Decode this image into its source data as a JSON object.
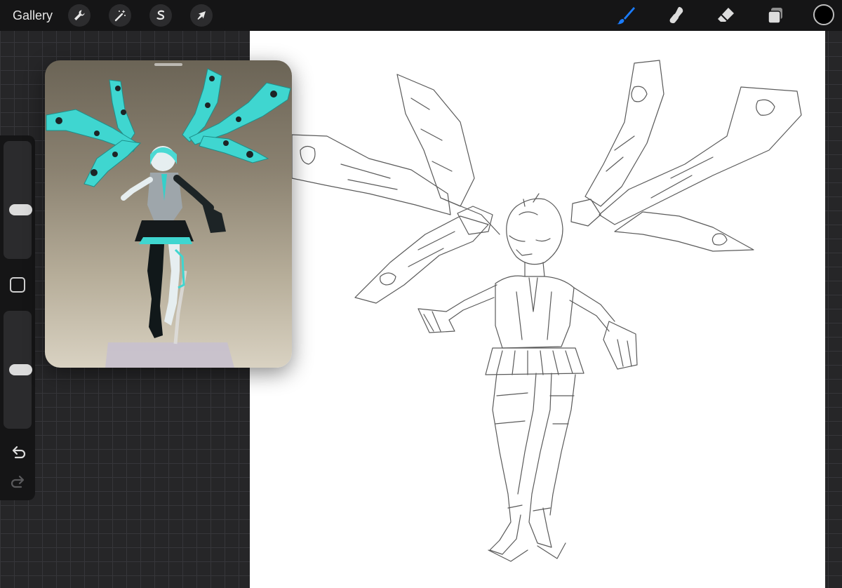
{
  "topbar": {
    "gallery_label": "Gallery",
    "left_tools": [
      {
        "name": "actions",
        "icon": "wrench-icon"
      },
      {
        "name": "adjustments",
        "icon": "magic-wand-icon"
      },
      {
        "name": "selection",
        "icon": "selection-s-icon"
      },
      {
        "name": "transform",
        "icon": "arrow-cursor-icon"
      }
    ],
    "right_tools": [
      {
        "name": "brush",
        "icon": "brush-icon",
        "active": true
      },
      {
        "name": "smudge",
        "icon": "smudge-icon"
      },
      {
        "name": "eraser",
        "icon": "eraser-icon"
      },
      {
        "name": "layers",
        "icon": "layers-icon"
      }
    ],
    "current_color": "#000000",
    "accent_color": "#1a7cff"
  },
  "sidebar": {
    "brush_size_level": 0.4,
    "opacity_level": 0.5,
    "icons": [
      "modify-square-icon",
      "undo-icon",
      "redo-icon"
    ]
  },
  "reference": {
    "palette": {
      "figure_teal": "#3fd6d0",
      "figure_dark": "#1d2426",
      "background_top": "#6b6456",
      "background_bottom": "#d9d2c2"
    }
  },
  "canvas": {
    "background": "#ffffff",
    "sketch_stroke": "#5a5a5a"
  }
}
